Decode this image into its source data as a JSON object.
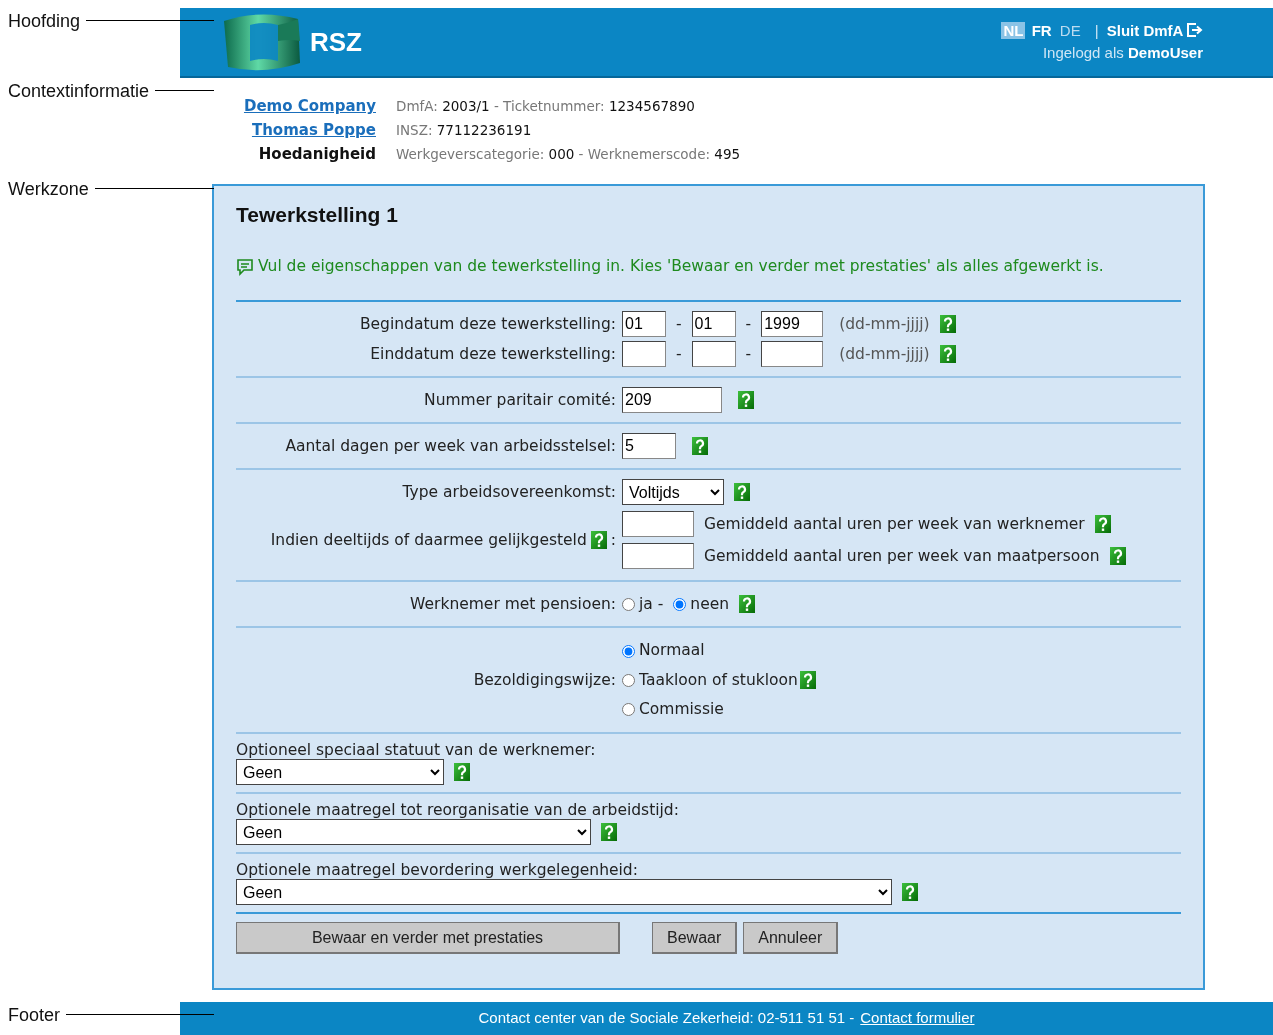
{
  "annotations": [
    {
      "label": "Hoofding"
    },
    {
      "label": "Contextinformatie"
    },
    {
      "label": "Werkzone"
    },
    {
      "label": "Footer"
    }
  ],
  "header": {
    "logo_text": "RSZ",
    "languages": [
      {
        "label": "NL",
        "selected": true,
        "disabled": false
      },
      {
        "label": "FR",
        "selected": false,
        "disabled": false
      },
      {
        "label": "DE",
        "selected": false,
        "disabled": true
      }
    ],
    "divider": "|",
    "close_link": "Sluit DmfA",
    "login_prefix": "Ingelogd als",
    "login_user": "DemoUser"
  },
  "context": {
    "links": [
      "Demo Company",
      "Thomas Poppe"
    ],
    "role": "Hoedanigheid",
    "lines": [
      [
        {
          "kind": "label",
          "text": "DmfA:"
        },
        {
          "kind": "value",
          "text": "2003/1"
        },
        {
          "kind": "label",
          "text": "- Ticketnummer:"
        },
        {
          "kind": "value",
          "text": "1234567890"
        }
      ],
      [
        {
          "kind": "label",
          "text": "INSZ:"
        },
        {
          "kind": "value",
          "text": "77112236191"
        }
      ],
      [
        {
          "kind": "label",
          "text": "Werkgeverscategorie:"
        },
        {
          "kind": "value",
          "text": "000"
        },
        {
          "kind": "label",
          "text": "- Werknemerscode:"
        },
        {
          "kind": "value",
          "text": "495"
        }
      ]
    ]
  },
  "form": {
    "title": "Tewerkstelling 1",
    "hint": "Vul de eigenschappen van de tewerkstelling in. Kies 'Bewaar en verder met prestaties' als alles afgewerkt is.",
    "sections": [
      {
        "rows": [
          {
            "kind": "date",
            "label": "Begindatum deze tewerkstelling:",
            "fields": [
              {
                "value": "01"
              },
              {
                "value": "01"
              },
              {
                "value": "1999"
              }
            ],
            "separators": [
              "-",
              "-"
            ],
            "format": "(dd-mm-jjjj)"
          },
          {
            "kind": "date",
            "label": "Einddatum deze tewerkstelling:",
            "separators": [
              "-",
              "-"
            ],
            "format": "(dd-mm-jjjj)"
          }
        ]
      },
      {
        "rows": [
          {
            "kind": "text",
            "label": "Nummer paritair comité:",
            "value": "209"
          }
        ]
      },
      {
        "rows": [
          {
            "kind": "number",
            "label": "Aantal dagen per week van arbeidsstelsel:",
            "value": "5"
          }
        ]
      },
      {
        "rows": [
          {
            "kind": "select",
            "label": "Type arbeidsovereenkomst:",
            "value": "Voltijds"
          },
          {
            "kind": "hours",
            "label": "Indien deeltijds of daarmee gelijkgesteld",
            "colon": ":",
            "fields": [
              {
                "caption": "Gemiddeld aantal uren per week van werknemer"
              },
              {
                "caption": "Gemiddeld aantal uren per week van maatpersoon"
              }
            ]
          }
        ]
      },
      {
        "rows": [
          {
            "kind": "radio-inline",
            "label": "Werknemer met pensioen:",
            "options": [
              {
                "label": "ja -",
                "selected": false
              },
              {
                "label": "neen",
                "selected": true
              }
            ]
          }
        ]
      },
      {
        "rows": [
          {
            "kind": "radio-stack",
            "label": "Bezoldigingswijze:",
            "options": [
              {
                "label": "Normaal",
                "selected": true,
                "help": false
              },
              {
                "label": "Taakloon of stukloon",
                "selected": false,
                "help": true
              },
              {
                "label": "Commissie",
                "selected": false,
                "help": false
              }
            ]
          }
        ]
      },
      {
        "rows": [
          {
            "kind": "select-short",
            "label": "Optioneel speciaal statuut van de werknemer:",
            "value": "Geen"
          }
        ]
      },
      {
        "rows": [
          {
            "kind": "select-medium",
            "label": "Optionele maatregel tot reorganisatie van de arbeidstijd:",
            "value": "Geen"
          }
        ]
      },
      {
        "rows": [
          {
            "kind": "select-wide",
            "label": "Optionele maatregel bevordering werkgelegenheid:",
            "value": "Geen"
          }
        ]
      }
    ],
    "buttons": [
      {
        "label": "Bewaar en verder met prestaties",
        "kind": "wide"
      },
      {
        "label": "Bewaar",
        "kind": "normal"
      },
      {
        "label": "Annuleer",
        "kind": "normal"
      }
    ]
  },
  "footer": {
    "text": "Contact center van de Sociale Zekerheid: 02-511 51 51 -",
    "link": "Contact formulier"
  }
}
